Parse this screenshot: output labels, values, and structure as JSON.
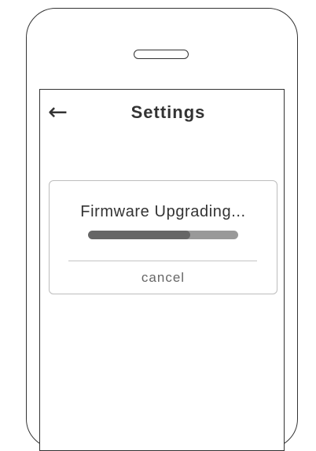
{
  "header": {
    "back_glyph": "←",
    "title": "Settings"
  },
  "dialog": {
    "title": "Firmware Upgrading...",
    "progress": 0.68,
    "cancel_label": "cancel"
  },
  "colors": {
    "outline": "#333333",
    "progress_fill": "#666666",
    "progress_track": "#999999",
    "dialog_border": "#bdbdbd",
    "cancel_text": "#666666"
  },
  "icons": {
    "back": "left-arrow-icon"
  }
}
